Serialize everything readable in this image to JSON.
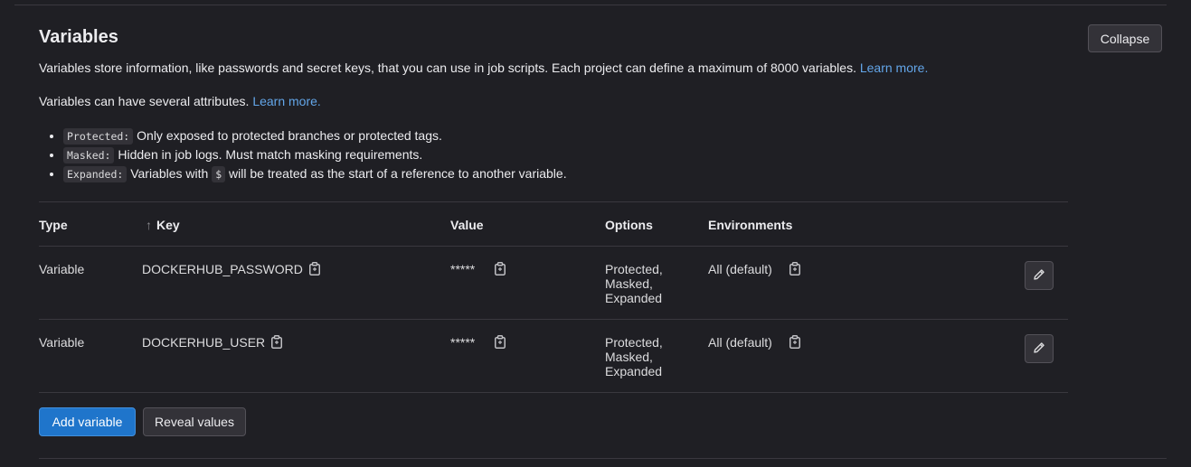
{
  "section": {
    "title": "Variables",
    "collapse_label": "Collapse",
    "description": "Variables store information, like passwords and secret keys, that you can use in job scripts. Each project can define a maximum of 8000 variables.",
    "description_link": "Learn more.",
    "attributes_intro": "Variables can have several attributes.",
    "attributes_link": "Learn more.",
    "attributes": [
      {
        "code": "Protected:",
        "text": " Only exposed to protected branches or protected tags."
      },
      {
        "code": "Masked:",
        "text": " Hidden in job logs. Must match masking requirements."
      },
      {
        "code": "Expanded:",
        "text_before": " Variables with ",
        "inline_code": "$",
        "text_after": " will be treated as the start of a reference to another variable."
      }
    ]
  },
  "table": {
    "headers": {
      "type": "Type",
      "sort_icon": "arrow-up-icon",
      "key": "Key",
      "value": "Value",
      "options": "Options",
      "environments": "Environments"
    },
    "rows": [
      {
        "type": "Variable",
        "key": "DOCKERHUB_PASSWORD",
        "value": "*****",
        "options": [
          "Protected,",
          "Masked,",
          "Expanded"
        ],
        "environment": "All (default)"
      },
      {
        "type": "Variable",
        "key": "DOCKERHUB_USER",
        "value": "*****",
        "options": [
          "Protected,",
          "Masked,",
          "Expanded"
        ],
        "environment": "All (default)"
      }
    ]
  },
  "actions": {
    "add_label": "Add variable",
    "reveal_label": "Reveal values"
  },
  "colors": {
    "background": "#1f1f24",
    "link": "#63a6e9",
    "primary": "#1f75cb",
    "button": "#333238",
    "border": "#535158"
  }
}
